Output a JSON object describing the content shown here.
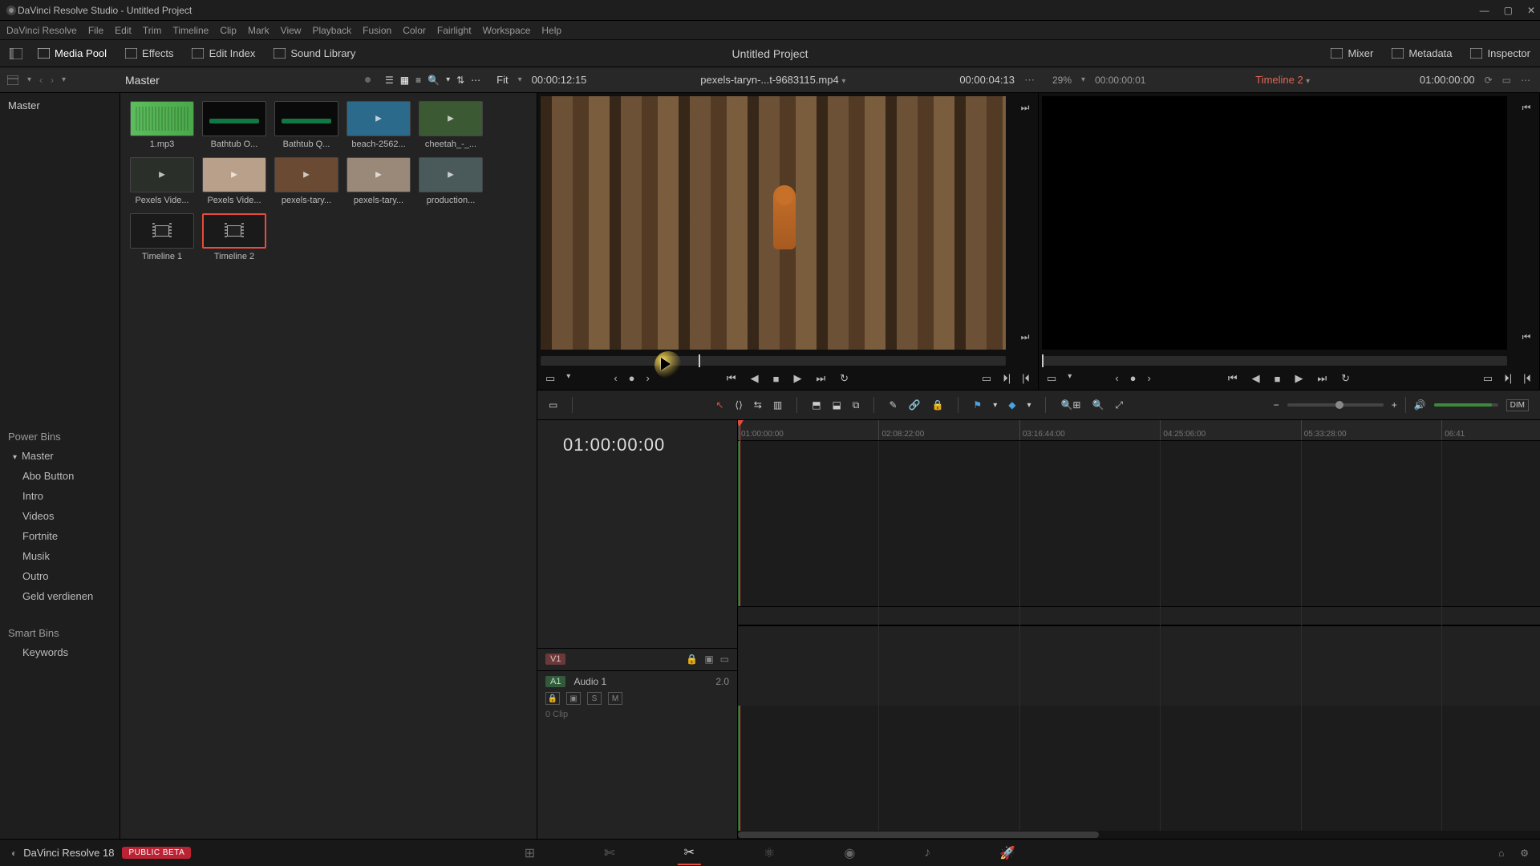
{
  "window": {
    "title": "DaVinci Resolve Studio - Untitled Project"
  },
  "menubar": [
    "DaVinci Resolve",
    "File",
    "Edit",
    "Trim",
    "Timeline",
    "Clip",
    "Mark",
    "View",
    "Playback",
    "Fusion",
    "Color",
    "Fairlight",
    "Workspace",
    "Help"
  ],
  "toolbar": {
    "left": [
      {
        "label": "Media Pool",
        "icon": "media-pool-icon",
        "active": true
      },
      {
        "label": "Effects",
        "icon": "effects-icon"
      },
      {
        "label": "Edit Index",
        "icon": "edit-index-icon"
      },
      {
        "label": "Sound Library",
        "icon": "sound-library-icon"
      }
    ],
    "center": "Untitled Project",
    "right": [
      {
        "label": "Mixer",
        "icon": "mixer-icon"
      },
      {
        "label": "Metadata",
        "icon": "metadata-icon"
      },
      {
        "label": "Inspector",
        "icon": "inspector-icon"
      }
    ]
  },
  "secbar": {
    "bin": "Master",
    "src_fit": "Fit",
    "src_dur": "00:00:12:15",
    "src_name": "pexels-taryn-...t-9683115.mp4",
    "src_tc": "00:00:04:13",
    "tl_zoom": "29%",
    "tl_tc_small": "00:00:00:01",
    "tl_name": "Timeline 2",
    "tl_tc": "01:00:00:00"
  },
  "sidebar": {
    "top": "Master",
    "powerbins_title": "Power Bins",
    "powerbins": [
      "Master",
      "Abo Button",
      "Intro",
      "Videos",
      "Fortnite",
      "Musik",
      "Outro",
      "Geld verdienen"
    ],
    "smartbins_title": "Smart Bins",
    "smartbins": [
      "Keywords"
    ]
  },
  "clips": [
    {
      "name": "1.mp3",
      "kind": "audio"
    },
    {
      "name": "Bathtub O...",
      "kind": "black"
    },
    {
      "name": "Bathtub Q...",
      "kind": "black"
    },
    {
      "name": "beach-2562...",
      "kind": "img",
      "bg": "#2c6a8c"
    },
    {
      "name": "cheetah_-_...",
      "kind": "img",
      "bg": "#3b5a33"
    },
    {
      "name": "Pexels Vide...",
      "kind": "img",
      "bg": "#2a2f2a"
    },
    {
      "name": "Pexels Vide...",
      "kind": "img",
      "bg": "#b8a08a"
    },
    {
      "name": "pexels-tary...",
      "kind": "img",
      "bg": "#6a4a33"
    },
    {
      "name": "pexels-tary...",
      "kind": "img",
      "bg": "#9a8878"
    },
    {
      "name": "production...",
      "kind": "img",
      "bg": "#4a5a5a"
    },
    {
      "name": "Timeline 1",
      "kind": "tl"
    },
    {
      "name": "Timeline 2",
      "kind": "tl",
      "selected": true
    }
  ],
  "timeline": {
    "tc": "01:00:00:00",
    "ruler": [
      "01:00:00:00",
      "02:08:22:00",
      "03:16:44:00",
      "04:25:06:00",
      "05:33:28:00",
      "06:41"
    ],
    "vtrack": {
      "tag": "V1"
    },
    "atrack": {
      "tag": "A1",
      "name": "Audio 1",
      "ch": "2.0",
      "sub": "0 Clip"
    }
  },
  "pagebar": {
    "app": "DaVinci Resolve 18",
    "badge": "PUBLIC BETA"
  }
}
